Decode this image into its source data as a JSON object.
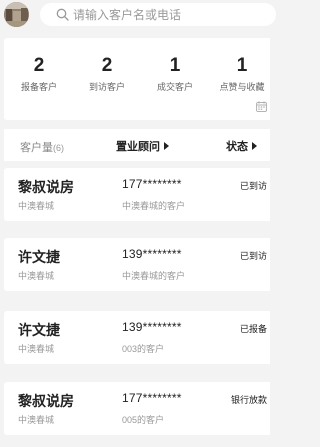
{
  "search": {
    "placeholder": "请输入客户名或电话"
  },
  "stats": [
    {
      "value": "2",
      "label": "报备客户"
    },
    {
      "value": "2",
      "label": "到访客户"
    },
    {
      "value": "1",
      "label": "成交客户"
    },
    {
      "value": "1",
      "label": "点赞与收藏"
    }
  ],
  "filter": {
    "count_label": "客户量",
    "count": "(6)",
    "adviser_label": "置业顾问",
    "status_label": "状态"
  },
  "customers": [
    {
      "name": "黎叔说房",
      "phone": "177********",
      "status": "已到访",
      "project": "中澳春城",
      "source": "中澳春城的客户"
    },
    {
      "name": "许文捷",
      "phone": "139********",
      "status": "已到访",
      "project": "中澳春城",
      "source": "中澳春城的客户"
    },
    {
      "name": "许文捷",
      "phone": "139********",
      "status": "已报备",
      "project": "中澳春城",
      "source": "003的客户"
    },
    {
      "name": "黎叔说房",
      "phone": "177********",
      "status": "银行放款",
      "project": "中澳春城",
      "source": "005的客户"
    }
  ],
  "icons": {
    "search": "search-icon",
    "calendar": "calendar-icon",
    "dropdown": "triangle-right-icon"
  },
  "colors": {
    "background": "#f3f3f3",
    "card": "#ffffff",
    "muted_text": "#999999"
  }
}
